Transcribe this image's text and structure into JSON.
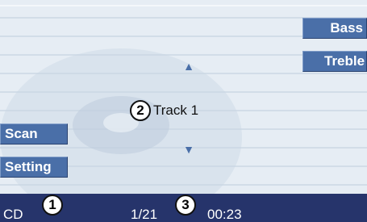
{
  "menu": {
    "bass_label": "Bass",
    "treble_label": "Treble",
    "scan_label": "Scan",
    "setting_label": "Setting"
  },
  "display": {
    "track_title": "Track 1",
    "arrow_up_icon": "triangle-up-icon",
    "arrow_down_icon": "triangle-down-icon"
  },
  "callouts": {
    "one": "1",
    "two": "2",
    "three": "3"
  },
  "status": {
    "source": "CD",
    "track_count": "1/21",
    "play_time": "00:23"
  },
  "colors": {
    "button": "#4a6fa8",
    "status_bar": "#26346b",
    "background": "#dfe7f0"
  }
}
